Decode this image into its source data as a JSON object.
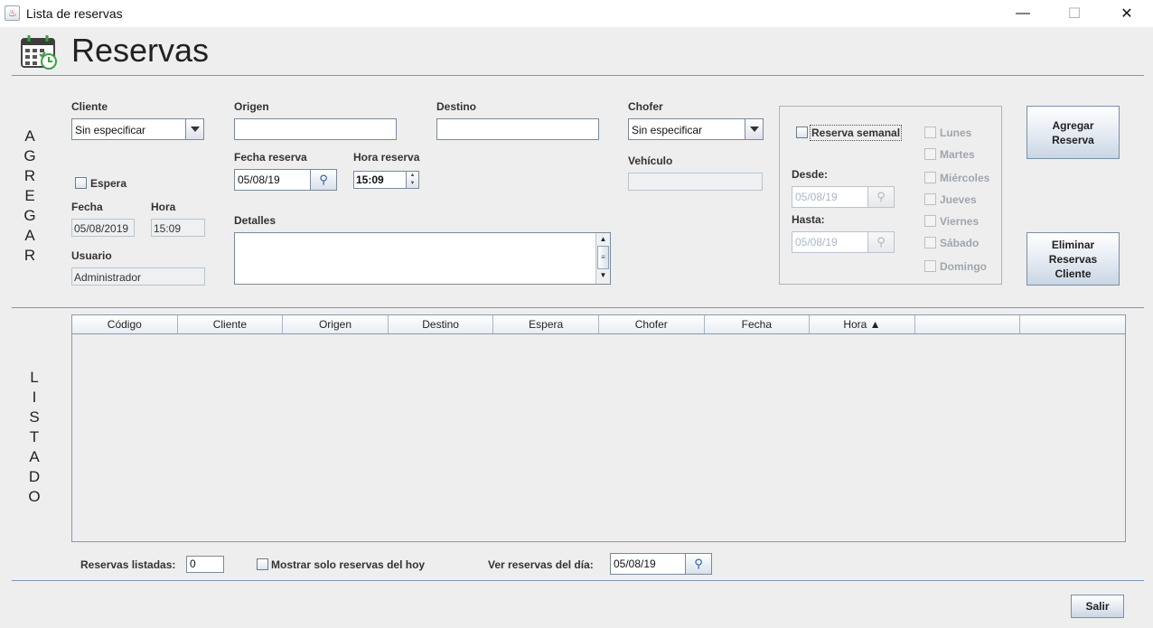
{
  "window": {
    "title": "Lista de reservas",
    "controls": [
      "—",
      "☐",
      "✕"
    ]
  },
  "header": {
    "title": "Reservas",
    "icon": "calendar-clock-icon"
  },
  "sections": {
    "add_letters": [
      "A",
      "G",
      "R",
      "E",
      "G",
      "A",
      "R"
    ],
    "list_letters": [
      "L",
      "I",
      "S",
      "T",
      "A",
      "D",
      "O"
    ]
  },
  "form": {
    "cliente": {
      "label": "Cliente",
      "value": "Sin especificar"
    },
    "espera": {
      "label": "Espera",
      "checked": false
    },
    "fecha": {
      "label": "Fecha",
      "value": "05/08/2019"
    },
    "hora": {
      "label": "Hora",
      "value": "15:09"
    },
    "usuario": {
      "label": "Usuario",
      "value": "Administrador"
    },
    "origen": {
      "label": "Origen",
      "value": ""
    },
    "destino": {
      "label": "Destino",
      "value": ""
    },
    "fecha_reserva": {
      "label": "Fecha reserva",
      "value": "05/08/19"
    },
    "hora_reserva": {
      "label": "Hora reserva",
      "value": "15:09"
    },
    "detalles": {
      "label": "Detalles",
      "value": ""
    },
    "chofer": {
      "label": "Chofer",
      "value": "Sin especificar"
    },
    "vehiculo": {
      "label": "Vehículo",
      "value": ""
    }
  },
  "weekly": {
    "label": "Reserva semanal",
    "checked": false,
    "desde": {
      "label": "Desde:",
      "value": "05/08/19"
    },
    "hasta": {
      "label": "Hasta:",
      "value": "05/08/19"
    },
    "days": [
      "Lunes",
      "Martes",
      "Miércoles",
      "Jueves",
      "Viernes",
      "Sábado",
      "Domingo"
    ]
  },
  "buttons": {
    "agregar": "Agregar\nReserva",
    "eliminar": "Eliminar\nReservas\nCliente",
    "salir": "Salir"
  },
  "table": {
    "columns": [
      "Código",
      "Cliente",
      "Origen",
      "Destino",
      "Espera",
      "Chofer",
      "Fecha",
      "Hora ▲",
      "",
      ""
    ],
    "rows": []
  },
  "footer": {
    "listadas_label": "Reservas listadas:",
    "listadas_value": "0",
    "mostrar_hoy_label": "Mostrar solo reservas del hoy",
    "ver_dia_label": "Ver reservas del día:",
    "ver_dia_value": "05/08/19"
  }
}
